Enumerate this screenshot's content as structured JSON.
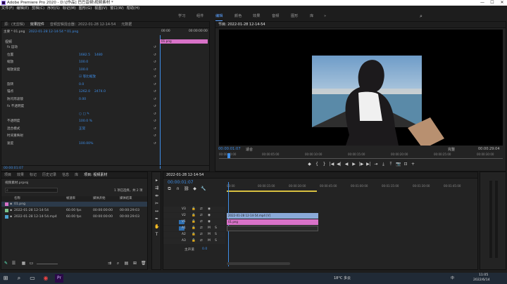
{
  "window": {
    "title": "Adobe Premiere Pro 2020 - D:\\[作品] 巴巴音频\\视频素材 *",
    "minimize": "—",
    "maximize": "☐",
    "close": "✕"
  },
  "menu": [
    "文件(F)",
    "编辑(E)",
    "剪辑(C)",
    "序列(S)",
    "标记(M)",
    "图形(G)",
    "视图(V)",
    "窗口(W)",
    "帮助(H)"
  ],
  "workspaces": {
    "items": [
      "学习",
      "组件",
      "编辑",
      "颜色",
      "效果",
      "音频",
      "图形",
      "库"
    ],
    "active": "编辑",
    "more": "»"
  },
  "effect_controls": {
    "tabs": [
      "源：(无剪辑)",
      "效果控件",
      "音频剪辑混合器：2022-01-28 12-14-54",
      "元数据"
    ],
    "active_tab": "效果控件",
    "clip": "主要 * 01.png",
    "sequence": "2022-01-28 12-14-54 * 01.png",
    "time_start": "00:00",
    "time_end": "00:00:00:00",
    "clip_bar": "01.png",
    "section_video": "视频",
    "rows": [
      {
        "label": "fx 运动",
        "value": ""
      },
      {
        "label": "位置",
        "value": "1682.5",
        "value2": "1480"
      },
      {
        "label": "缩放",
        "value": "100.0",
        "value2": ""
      },
      {
        "label": "缩放宽度",
        "value": "100.0",
        "value2": ""
      },
      {
        "label": "",
        "value": "☑ 等比缩放",
        "value2": ""
      },
      {
        "label": "旋转",
        "value": "0.0",
        "value2": ""
      },
      {
        "label": "锚点",
        "value": "1262.0",
        "value2": "2474.0"
      },
      {
        "label": "防闪烁滤镜",
        "value": "0.00",
        "value2": ""
      },
      {
        "label": "fx 不透明度",
        "value": "",
        "value2": ""
      },
      {
        "label": "",
        "value": "○ □ ✎",
        "value2": ""
      },
      {
        "label": "不透明度",
        "value": "100.0 %",
        "value2": ""
      },
      {
        "label": "混合模式",
        "value": "正常",
        "value2": ""
      },
      {
        "label": "时间重映射",
        "value": "",
        "value2": ""
      },
      {
        "label": "速度",
        "value": "100.00%",
        "value2": ""
      }
    ],
    "footer_time": "00:00:01:07"
  },
  "program": {
    "title": "节目: 2022-01-28 12-14-54",
    "timecode": "00:00:01:07",
    "fit": "适合",
    "quality": "完整",
    "duration": "00:00:29:04",
    "ruler": [
      "00:00:00:00",
      "00:00:05:00",
      "00:00:10:00",
      "00:00:15:00",
      "00:00:20:00",
      "00:00:25:00",
      "00:00:30:00"
    ],
    "controls": [
      "◆",
      "{",
      "}",
      "|◀",
      "◀|",
      "◀",
      "▶",
      "|▶",
      "▶|",
      "⇥",
      "⤓",
      "⤒",
      "📷",
      "⊡",
      "+"
    ]
  },
  "project": {
    "tabs": [
      "项目",
      "效果",
      "标记",
      "历史记录",
      "信息",
      "库",
      "项目: 视频素材"
    ],
    "active_tab": "项目: 视频素材",
    "name": "视频素材.prproj",
    "search_placeholder": "",
    "selection": "1 项已选择，共 2 项",
    "columns": [
      "名称",
      "帧速率",
      "媒体开始",
      "媒体结束"
    ],
    "items": [
      {
        "color": "#d872c8",
        "name": "01.png",
        "fps": "",
        "start": "",
        "end": ""
      },
      {
        "color": "#7ac28a",
        "name": "2022-01-28 12-14-54",
        "fps": "60.00 fps",
        "start": "00:00:00:00",
        "end": "00:00:29:03"
      },
      {
        "color": "#4aa0cf",
        "name": "2022-01-28 12-14-54.mp4",
        "fps": "60.00 fps",
        "start": "00:00:00:00",
        "end": "00:00:29:03"
      }
    ]
  },
  "timeline": {
    "title": "2022-01-28 12-14-54",
    "timecode": "00:00:01:07",
    "ruler": [
      "00:00",
      "00:00:15:00",
      "00:00:30:00",
      "00:00:45:00",
      "00:01:00:00",
      "00:01:15:00",
      "00:01:30:00",
      "00:01:45:00"
    ],
    "tracks": [
      {
        "label": "V3",
        "type": "video"
      },
      {
        "label": "V2",
        "type": "video"
      },
      {
        "label": "V1",
        "type": "video"
      },
      {
        "label": "A1",
        "type": "audio"
      },
      {
        "label": "A2",
        "type": "audio"
      },
      {
        "label": "A3",
        "type": "audio"
      }
    ],
    "clips": [
      {
        "track": "V2",
        "name": "2022-01-28 12-14-54.mp4 [V]",
        "color": "#8aa9d8"
      },
      {
        "track": "V1",
        "name": "01.png",
        "color": "#d872c8"
      }
    ],
    "master": "主声道",
    "master_value": "0.0"
  },
  "taskbar": {
    "weather": "18°C 多云",
    "ime": "中",
    "time": "11:05",
    "date": "2022/6/14"
  }
}
